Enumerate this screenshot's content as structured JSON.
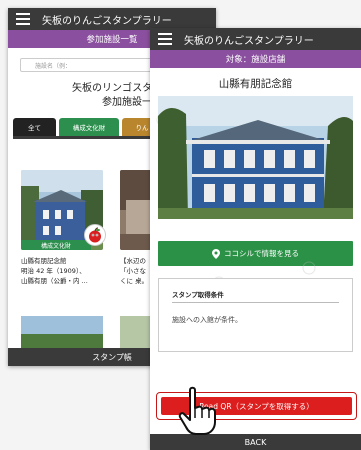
{
  "back_screen": {
    "app_title": "矢板のりんごスタンプラリー",
    "subtitle": "参加施設一覧",
    "search_placeholder": "施設名（例：",
    "heading_line1": "矢板のリンゴスタンプ",
    "heading_line2": "参加施設一覧",
    "tabs": [
      {
        "label": "全て",
        "color": "#222222"
      },
      {
        "label": "構成文化財",
        "color": "#2d8f4e"
      },
      {
        "label": "りん",
        "color": "#b9862e"
      }
    ],
    "cards": [
      {
        "category": "構成文化財",
        "line1": "山縣有朋記念館",
        "line2": "明治 42 年（1909）、",
        "line3": "山縣有朋（公爵・内 ..."
      },
      {
        "line1": "【水辺の",
        "line2": "「小さな",
        "line3": "くに 桌。"
      }
    ],
    "bottom_label": "スタンプ帳"
  },
  "front_screen": {
    "app_title": "矢板のりんごスタンプラリー",
    "subtitle": "対象：施設店舗",
    "title": "山縣有朋記念館",
    "info_button": "ココシルで情報を見る",
    "condition_title": "スタンプ取得条件",
    "condition_body": "施設への入館が条件。",
    "read_button": "Read QR（スタンプを取得する）",
    "back_label": "BACK"
  },
  "colors": {
    "appbar": "#3a3a3a",
    "purple": "#8a4f9e",
    "green": "#2a9146",
    "red": "#dc1e1e"
  }
}
